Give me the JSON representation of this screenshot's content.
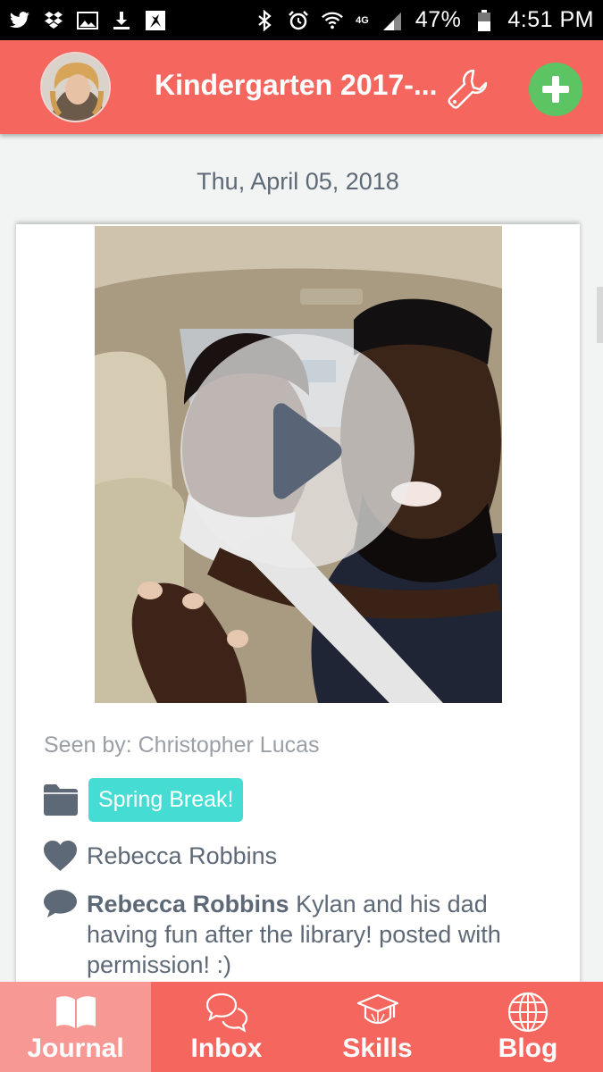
{
  "status_bar": {
    "left_icons": [
      "twitter-icon",
      "dropbox-icon",
      "image-icon",
      "download-icon",
      "app-icon"
    ],
    "network": "4G",
    "battery": "47%",
    "time": "4:51 PM"
  },
  "header": {
    "title": "Kindergarten 2017-...",
    "settings_icon": "wrench-icon",
    "add_icon": "plus-icon",
    "colors": {
      "background": "#f4665e",
      "add_button": "#5cc462"
    }
  },
  "post": {
    "date": "Thu, April 05, 2018",
    "media": {
      "type": "video",
      "play_icon": "play-icon"
    },
    "seen_by": "Seen by: Christopher Lucas",
    "folder_tag": "Spring Break!",
    "liked_by": "Rebecca Robbins",
    "comment": {
      "author": "Rebecca Robbins",
      "text": " Kylan and his dad having fun after the library! posted with permission! :)"
    },
    "colors": {
      "tag": "#45dcd3",
      "text": "#5e6978"
    }
  },
  "bottom_nav": {
    "items": [
      {
        "label": "Journal",
        "icon": "book-icon",
        "active": true
      },
      {
        "label": "Inbox",
        "icon": "chat-bubbles-icon",
        "active": false
      },
      {
        "label": "Skills",
        "icon": "graduation-cap-icon",
        "active": false
      },
      {
        "label": "Blog",
        "icon": "globe-icon",
        "active": false
      }
    ]
  }
}
